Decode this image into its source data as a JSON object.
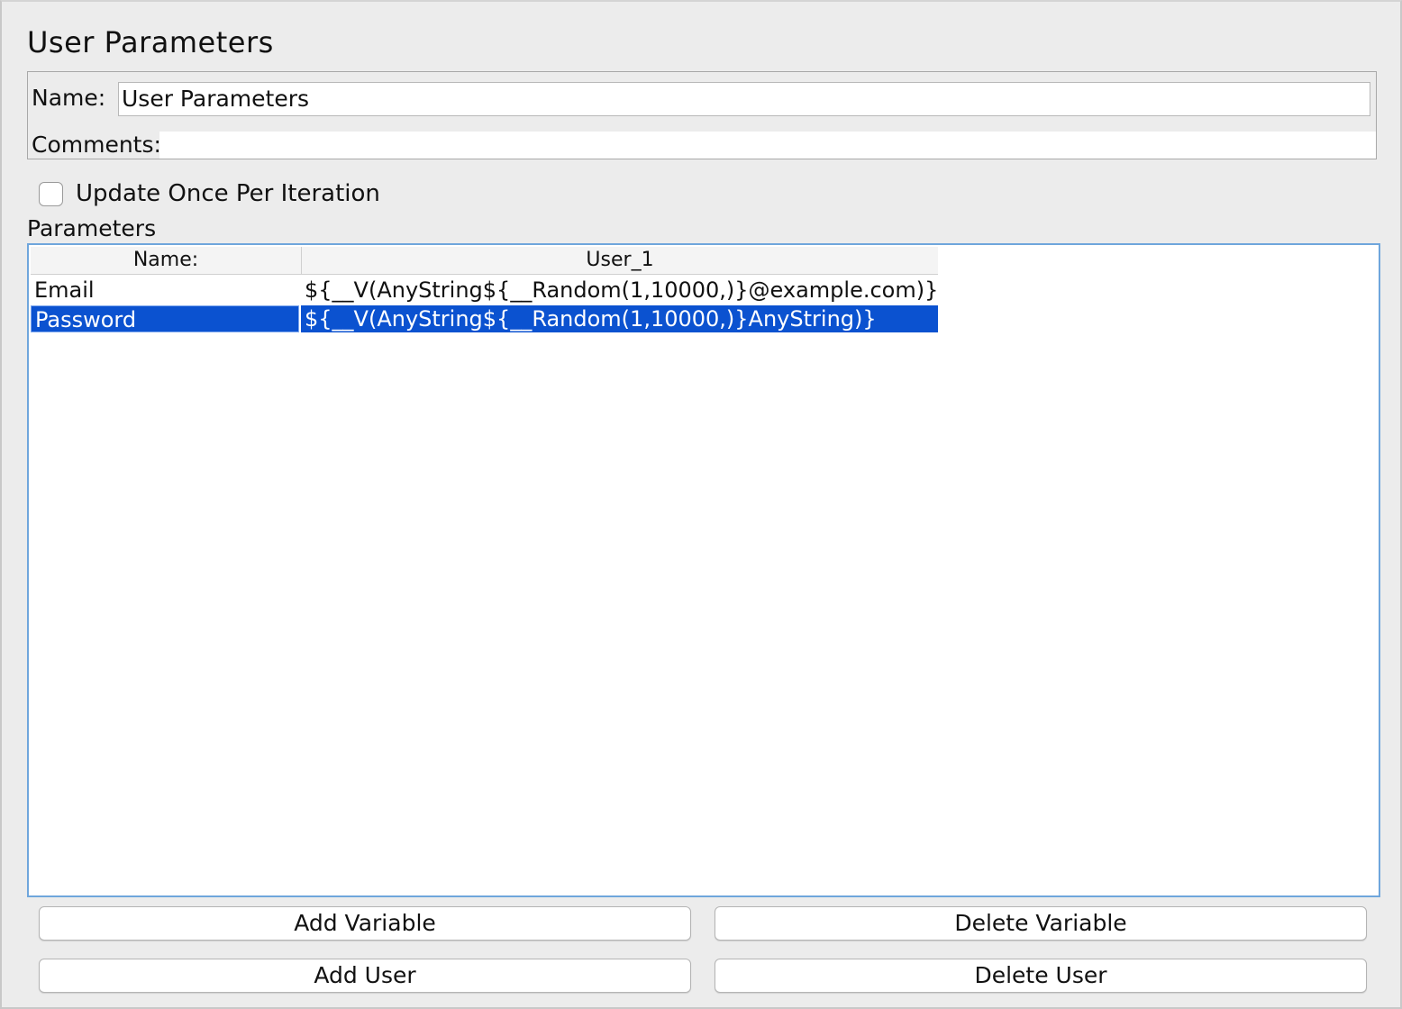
{
  "header": {
    "title": "User Parameters"
  },
  "form": {
    "name_label": "Name:",
    "name_value": "User Parameters",
    "comments_label": "Comments:",
    "comments_value": ""
  },
  "options": {
    "update_once_label": "Update Once Per Iteration",
    "update_once_checked": false
  },
  "parameters": {
    "section_label": "Parameters",
    "columns": [
      "Name:",
      "User_1"
    ],
    "rows": [
      {
        "name": "Email",
        "user_1": "${__V(AnyString${__Random(1,10000,)}@example.com)}",
        "selected": false
      },
      {
        "name": "Password",
        "user_1": "${__V(AnyString${__Random(1,10000,)}AnyString)}",
        "selected": true
      }
    ],
    "selection_color": "#0b52d0"
  },
  "buttons": {
    "add_variable": "Add Variable",
    "delete_variable": "Delete Variable",
    "add_user": "Add User",
    "delete_user": "Delete User"
  }
}
